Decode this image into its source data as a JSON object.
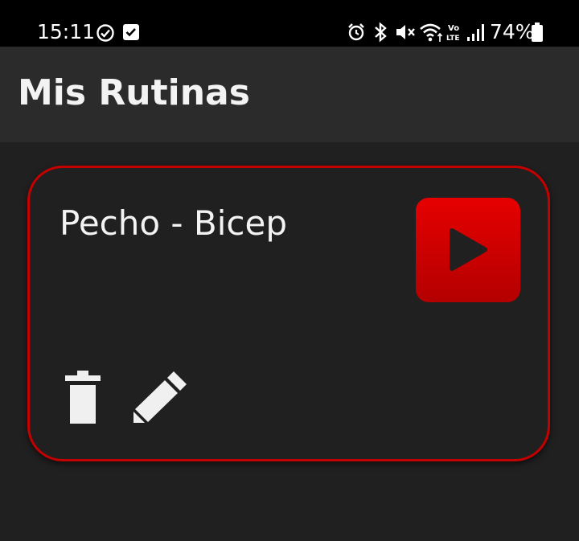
{
  "status_bar": {
    "time": "15:11",
    "battery": "74%",
    "icons": [
      "check-circle-icon",
      "checkbox-icon",
      "alarm-icon",
      "bluetooth-icon",
      "mute-icon",
      "wifi-icon",
      "volte-icon",
      "signal-icon",
      "battery-icon"
    ]
  },
  "app_bar": {
    "title": "Mis Rutinas"
  },
  "routines": [
    {
      "name": "Pecho - Bicep",
      "actions": [
        "play-icon",
        "trash-icon",
        "pencil-icon"
      ]
    }
  ],
  "colors": {
    "background": "#202020",
    "app_bar": "#2b2b2b",
    "status_bar": "#000000",
    "accent": "#e60000",
    "card_border": "#c40000",
    "text": "#f3f3f3"
  }
}
